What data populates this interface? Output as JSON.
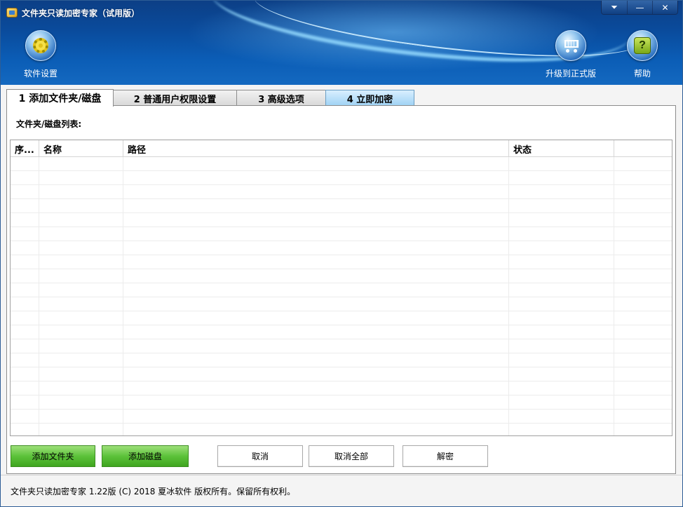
{
  "window": {
    "title": "文件夹只读加密专家（试用版）",
    "controls": {
      "menu": "⏷",
      "minimize": "—",
      "close": "✕"
    }
  },
  "toolbar": {
    "settings_label": "软件设置",
    "upgrade_label": "升级到正式版",
    "help_label": "帮助",
    "help_glyph": "?"
  },
  "tabs": [
    {
      "label": "1 添加文件夹/磁盘",
      "active": true
    },
    {
      "label": "2 普通用户权限设置",
      "active": false
    },
    {
      "label": "3 高级选项",
      "active": false
    },
    {
      "label": "4 立即加密",
      "active": false
    }
  ],
  "panel": {
    "list_label": "文件夹/磁盘列表:",
    "columns": [
      "序...",
      "名称",
      "路径",
      "状态",
      ""
    ],
    "rows": []
  },
  "buttons": {
    "add_folder": "添加文件夹",
    "add_disk": "添加磁盘",
    "cancel": "取消",
    "cancel_all": "取消全部",
    "decrypt": "解密"
  },
  "status_bar": {
    "text": "文件夹只读加密专家 1.22版 (C) 2018 夏冰软件 版权所有。保留所有权利。"
  },
  "colors": {
    "header_top": "#0c3f86",
    "header_bottom": "#1469c0",
    "green_button": "#5cc23a",
    "encrypt_tab": "#9ed2f4"
  }
}
